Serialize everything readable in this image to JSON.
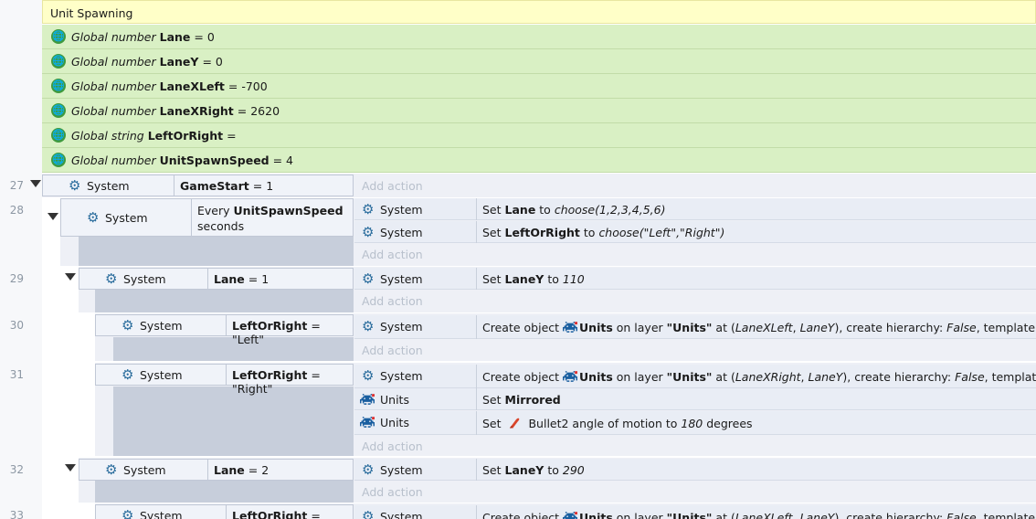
{
  "group": {
    "title": "Unit Spawning"
  },
  "globals": [
    {
      "kind": "Global number",
      "name": "Lane",
      "value": "= 0"
    },
    {
      "kind": "Global number",
      "name": "LaneY",
      "value": "= 0"
    },
    {
      "kind": "Global number",
      "name": "LaneXLeft",
      "value": "= -700"
    },
    {
      "kind": "Global number",
      "name": "LaneXRight",
      "value": "= 2620"
    },
    {
      "kind": "Global string",
      "name": "LeftOrRight",
      "value": "="
    },
    {
      "kind": "Global number",
      "name": "UnitSpawnSpeed",
      "value": "= 4"
    }
  ],
  "labels": {
    "add_action": "Add action",
    "system": "System",
    "units": "Units"
  },
  "events": {
    "e27": {
      "num": "27",
      "cond_name": "GameStart",
      "cond_rest": "= 1"
    },
    "e28": {
      "num": "28",
      "cond_line1a": "Every",
      "cond_line1b": "UnitSpawnSpeed",
      "cond_line2": "seconds",
      "a1": {
        "pre": "Set",
        "name": "Lane",
        "mid": "to",
        "expr": "choose(1,2,3,4,5,6)"
      },
      "a2": {
        "pre": "Set",
        "name": "LeftOrRight",
        "mid": "to",
        "expr": "choose(\"Left\",\"Right\")"
      }
    },
    "e29": {
      "num": "29",
      "cond_name": "Lane",
      "cond_rest": "= 1",
      "a1": {
        "pre": "Set",
        "name": "LaneY",
        "mid": "to",
        "expr": "110"
      }
    },
    "e30": {
      "num": "30",
      "cond_name": "LeftOrRight",
      "cond_rest": "= \"Left\"",
      "a1": {
        "pre": "Create object",
        "obj": "Units",
        "on": "on layer",
        "layer": "\"Units\"",
        "at": "at (",
        "x": "LaneXLeft",
        "comma": ",",
        "y": "LaneY",
        "tail1": "), create hierarchy:",
        "hier": "False",
        "tail2": ", template: \"\""
      }
    },
    "e31": {
      "num": "31",
      "cond_name": "LeftOrRight",
      "cond_rest": "= \"Right\"",
      "a1": {
        "pre": "Create object",
        "obj": "Units",
        "on": "on layer",
        "layer": "\"Units\"",
        "at": "at (",
        "x": "LaneXRight",
        "comma": ",",
        "y": "LaneY",
        "tail1": "), create hierarchy:",
        "hier": "False",
        "tail2": ", template: \"\""
      },
      "a2": {
        "pre": "Set",
        "name": "Mirrored"
      },
      "a3": {
        "pre": "Set",
        "beh": "Bullet2 angle of motion to",
        "val": "180",
        "unit": "degrees"
      }
    },
    "e32": {
      "num": "32",
      "cond_name": "Lane",
      "cond_rest": "= 2",
      "a1": {
        "pre": "Set",
        "name": "LaneY",
        "mid": "to",
        "expr": "290"
      }
    },
    "e33": {
      "num": "33",
      "cond_name": "LeftOrRight",
      "cond_rest": "= \"Left\"",
      "a1": {
        "pre": "Create object",
        "obj": "Units",
        "on": "on layer",
        "layer": "\"Units\"",
        "at": "at (",
        "x": "LaneXLeft",
        "comma": ",",
        "y": "LaneY",
        "tail1": "), create hierarchy:",
        "hier": "False",
        "tail2": ", template: \"\""
      }
    }
  },
  "colors": {
    "group_bg": "#ffffc8",
    "global_bg": "#d9f0c4",
    "event_bg": "#eef0f6",
    "gear": "#2b6d9d"
  },
  "icons": {
    "global": "globe-icon",
    "system": "gear-icon",
    "units": "space-invader-icon",
    "bullet": "bullet-icon"
  }
}
